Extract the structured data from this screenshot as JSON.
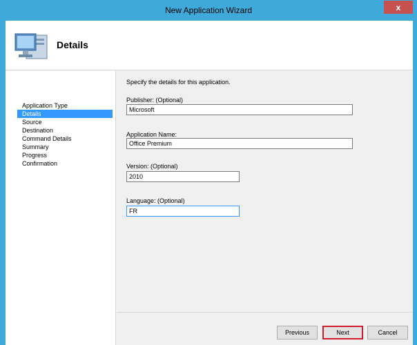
{
  "window": {
    "title": "New Application Wizard",
    "close_label": "x"
  },
  "header": {
    "title": "Details",
    "icon": "computer-monitor-icon"
  },
  "nav": {
    "items": [
      {
        "label": "Application Type",
        "active": false
      },
      {
        "label": "Details",
        "active": true
      },
      {
        "label": "Source",
        "active": false
      },
      {
        "label": "Destination",
        "active": false
      },
      {
        "label": "Command Details",
        "active": false
      },
      {
        "label": "Summary",
        "active": false
      },
      {
        "label": "Progress",
        "active": false
      },
      {
        "label": "Confirmation",
        "active": false
      }
    ]
  },
  "content": {
    "instruction": "Specify the details for this application.",
    "publisher": {
      "label": "Publisher: (Optional)",
      "value": "Microsoft"
    },
    "app_name": {
      "label": "Application Name:",
      "value": "Office Premium"
    },
    "version": {
      "label": "Version: (Optional)",
      "value": "2010"
    },
    "language": {
      "label": "Language: (Optional)",
      "value": "FR"
    }
  },
  "footer": {
    "previous_label": "Previous",
    "next_label": "Next",
    "cancel_label": "Cancel"
  },
  "colors": {
    "title_bar": "#3fa9d9",
    "close_button": "#c75050",
    "selected_nav": "#3399ff",
    "highlight_border": "#d11a2a"
  }
}
